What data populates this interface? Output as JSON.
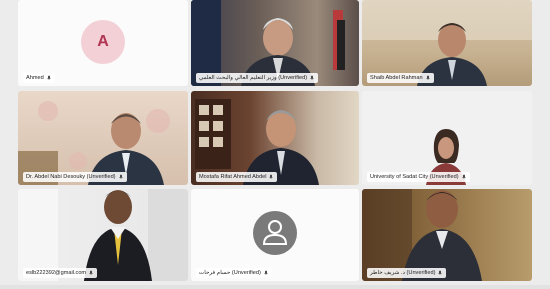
{
  "participants": [
    {
      "name": "Ahmed",
      "initial": "A"
    },
    {
      "name": "وزير التعليم العالي والبحث العلمي (Unverified)"
    },
    {
      "name": "Shaib Abdel Rahman"
    },
    {
      "name": "Dr. Abdel Nabi Desouky (Unverified)"
    },
    {
      "name": "Mostafa Rifat Ahmed Abdel"
    },
    {
      "name": "University of Sadat City (Unverified)"
    },
    {
      "name": "eslb222392@gmail.com"
    },
    {
      "name": "حسام فرحات (Unverified)"
    },
    {
      "name": "د. شريف خاطر (Unverified)"
    }
  ],
  "colors": {
    "background": "#ececec",
    "avatar_bg": "#f3d0d6",
    "avatar_text": "#b03552",
    "generic_avatar": "#7a7a7a"
  },
  "icons": {
    "mic": "mic-icon",
    "person": "person-icon"
  }
}
